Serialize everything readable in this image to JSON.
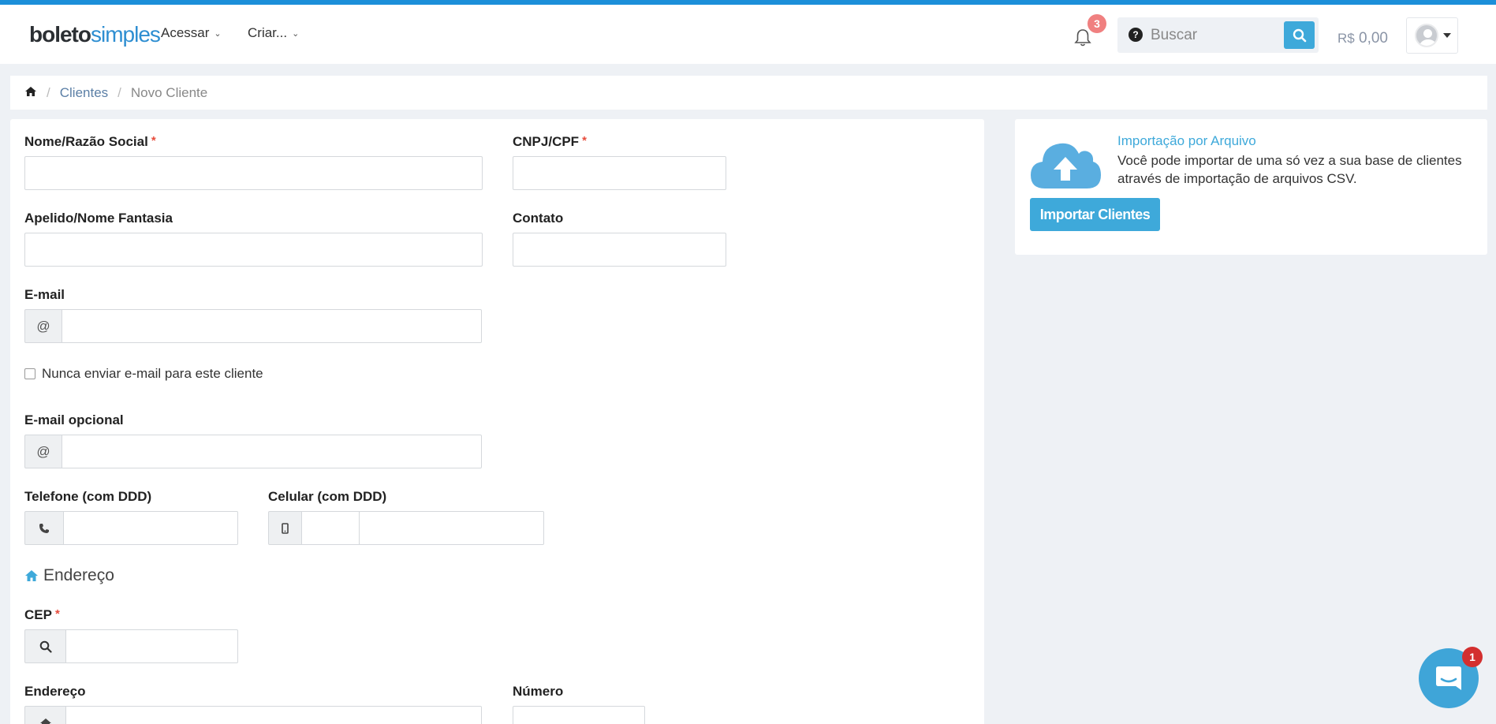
{
  "header": {
    "logo_part1": "boleto",
    "logo_part2": "simples",
    "nav": [
      {
        "label": "Acessar"
      },
      {
        "label": "Criar..."
      }
    ],
    "notifications_count": "3",
    "search_placeholder": "Buscar",
    "help_symbol": "?",
    "balance_currency": "R$",
    "balance_value": "0,00"
  },
  "breadcrumb": {
    "items": [
      "Clientes",
      "Novo Cliente"
    ],
    "separator": "/"
  },
  "form": {
    "name_label": "Nome/Razão Social",
    "cnpj_label": "CNPJ/CPF",
    "nickname_label": "Apelido/Nome Fantasia",
    "contact_label": "Contato",
    "email_label": "E-mail",
    "email_addon": "@",
    "never_email_label": "Nunca enviar e-mail para este cliente",
    "optional_email_label": "E-mail opcional",
    "optional_email_addon": "@",
    "phone_label": "Telefone (com DDD)",
    "mobile_label": "Celular (com DDD)",
    "address_section": "Endereço",
    "cep_label": "CEP",
    "address_label": "Endereço",
    "number_label": "Número",
    "required_mark": "*"
  },
  "import": {
    "title": "Importação por Arquivo",
    "description": "Você pode importar de uma só vez a sua base de clientes através de importação de arquivos CSV.",
    "button": "Importar Clientes"
  },
  "chat": {
    "badge": "1"
  },
  "colors": {
    "accent": "#3ea9da",
    "top_bar": "#1c8fd9",
    "required": "#e74c3c",
    "notification_badge": "#f08080",
    "chat_badge": "#d32f2f"
  }
}
